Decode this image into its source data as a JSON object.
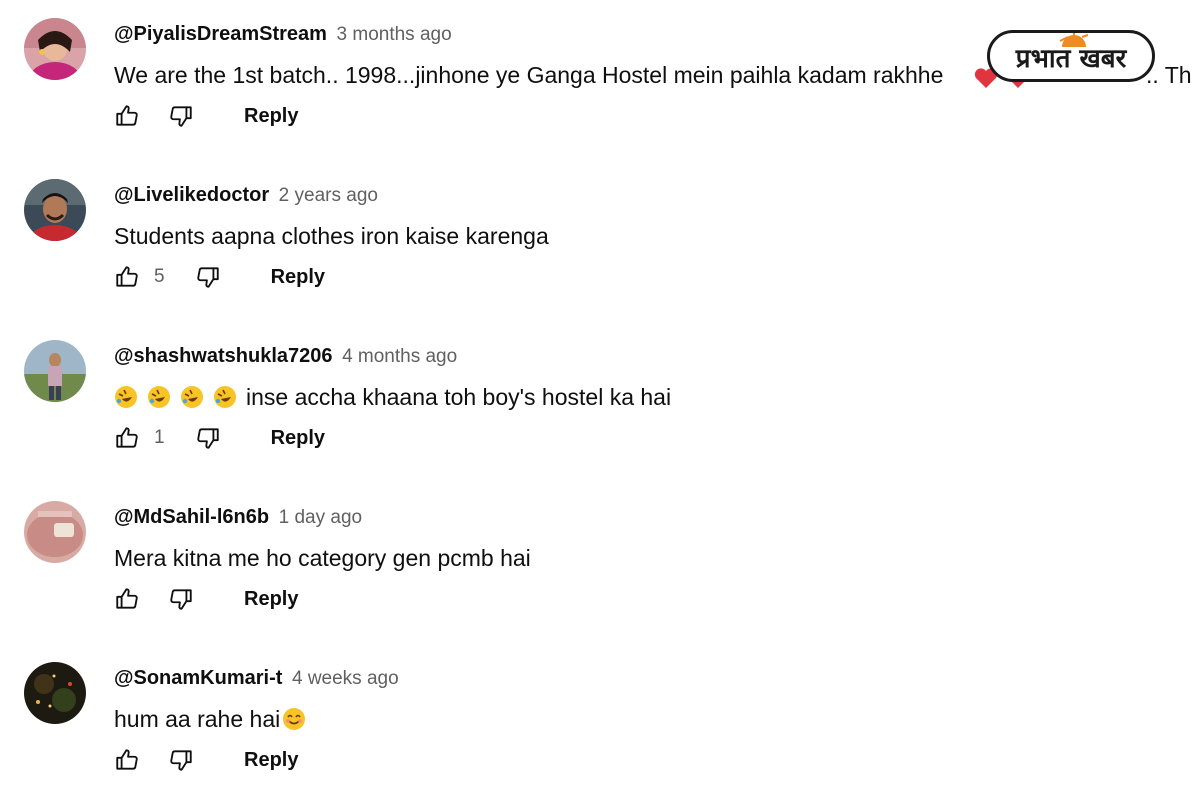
{
  "comments": [
    {
      "author": "@PiyalisDreamStream",
      "time": "3 months ago",
      "text": "We are the 1st batch.. 1998...jinhone ye Ganga Hostel mein paihla kadam rakhhe",
      "text_tail": ".. Th",
      "likes": "",
      "reply_label": "Reply",
      "avatar": "woman-portrait"
    },
    {
      "author": "@Livelikedoctor",
      "time": "2 years ago",
      "text": "Students aapna clothes iron kaise karenga",
      "likes": "5",
      "reply_label": "Reply",
      "avatar": "man-portrait"
    },
    {
      "author": "@shashwatshukla7206",
      "time": "4 months ago",
      "emoji_prefix": [
        "rofl-emoji",
        "rofl-emoji",
        "rofl-emoji",
        "rofl-emoji"
      ],
      "text": "inse accha khaana toh boy's hostel ka hai",
      "likes": "1",
      "reply_label": "Reply",
      "avatar": "person-outdoors"
    },
    {
      "author": "@MdSahil-l6n6b",
      "time": "1 day ago",
      "text": "Mera kitna me ho category gen pcmb hai",
      "likes": "",
      "reply_label": "Reply",
      "avatar": "pink-object"
    },
    {
      "author": "@SonamKumari-t",
      "time": "4 weeks ago",
      "text": "hum aa rahe hai",
      "emoji_suffix": "smile-emoji",
      "likes": "",
      "reply_label": "Reply",
      "avatar": "dark-sparkles"
    }
  ],
  "watermark": {
    "text": "प्रभात खबर",
    "brand_color": "#1a1a1a",
    "accent_color": "#f08a24"
  },
  "colors": {
    "text": "#0f0f0f",
    "meta": "#606060",
    "heart": "#e0353f"
  }
}
